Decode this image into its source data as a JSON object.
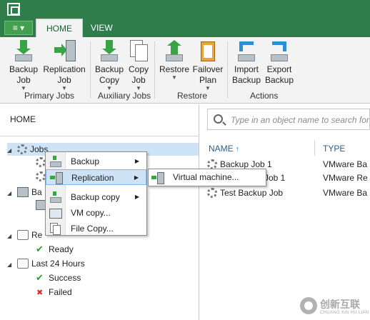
{
  "menu_button": {
    "label": "≡ ▾"
  },
  "tabs": [
    {
      "label": "HOME",
      "active": true
    },
    {
      "label": "VIEW",
      "active": false
    }
  ],
  "ribbon": {
    "buttons": {
      "backup_job": {
        "line1": "Backup",
        "line2": "Job"
      },
      "replication_job": {
        "line1": "Replication",
        "line2": "Job"
      },
      "backup_copy": {
        "line1": "Backup",
        "line2": "Copy"
      },
      "copy_job": {
        "line1": "Copy",
        "line2": "Job"
      },
      "restore": {
        "line1": "Restore",
        "line2": ""
      },
      "failover_plan": {
        "line1": "Failover",
        "line2": "Plan"
      },
      "import_backup": {
        "line1": "Import",
        "line2": "Backup"
      },
      "export_backup": {
        "line1": "Export",
        "line2": "Backup"
      }
    },
    "groups": {
      "primary": "Primary Jobs",
      "auxiliary": "Auxiliary Jobs",
      "restore": "Restore",
      "actions": "Actions"
    }
  },
  "nav": {
    "title": "HOME",
    "tree": {
      "jobs": "Jobs",
      "backups_partial": "Ba",
      "replicas_partial": "Re",
      "ready": "Ready",
      "last24": "Last 24 Hours",
      "success": "Success",
      "failed": "Failed"
    }
  },
  "context_menu": {
    "items": [
      {
        "label": "Backup",
        "submenu": true
      },
      {
        "label": "Replication",
        "submenu": true
      },
      {
        "label": "Backup copy",
        "submenu": true
      },
      {
        "label": "VM copy...",
        "submenu": false
      },
      {
        "label": "File Copy...",
        "submenu": false
      }
    ],
    "submenu_item": "Virtual machine..."
  },
  "search": {
    "placeholder": "Type in an object name to search for"
  },
  "table": {
    "columns": {
      "name": "NAME",
      "type": "TYPE"
    },
    "rows": [
      {
        "name": "Backup Job 1",
        "type": "VMware  Ba"
      },
      {
        "name": "Job 1",
        "type": "VMware  Re"
      },
      {
        "name": "Test Backup Job",
        "type": "VMware  Ba"
      }
    ]
  },
  "watermark": {
    "line1": "创新互联",
    "line2": "CHUANG XIN HU LIAN"
  }
}
